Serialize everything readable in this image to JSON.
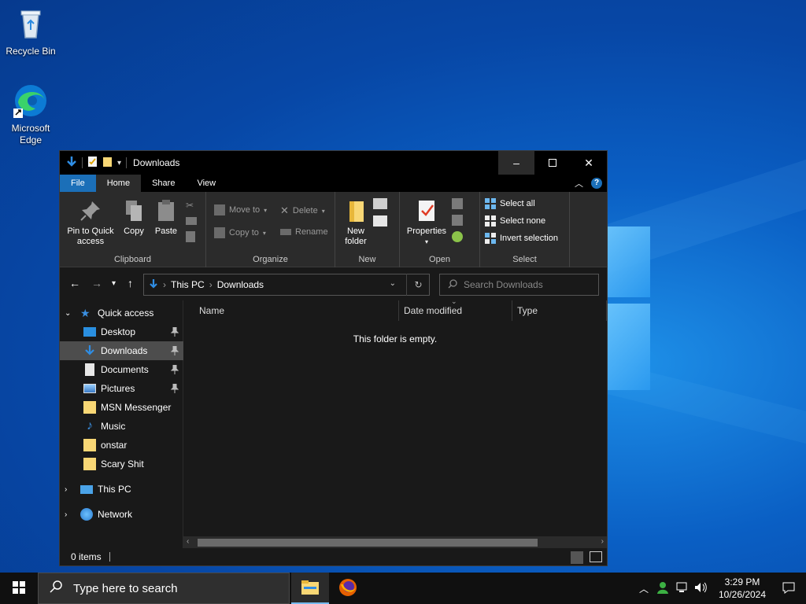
{
  "desktop": {
    "icons": [
      {
        "label": "Recycle Bin"
      },
      {
        "label_line1": "Microsoft",
        "label_line2": "Edge"
      }
    ]
  },
  "window": {
    "title": "Downloads",
    "tabs": [
      {
        "label": "File"
      },
      {
        "label": "Home"
      },
      {
        "label": "Share"
      },
      {
        "label": "View"
      }
    ],
    "ribbon": {
      "clipboard": {
        "pin_line1": "Pin to Quick",
        "pin_line2": "access",
        "copy": "Copy",
        "paste": "Paste",
        "label": "Clipboard"
      },
      "organize": {
        "move_to": "Move to",
        "copy_to": "Copy to",
        "delete": "Delete",
        "rename": "Rename",
        "label": "Organize"
      },
      "new": {
        "folder_line1": "New",
        "folder_line2": "folder",
        "label": "New"
      },
      "open": {
        "properties": "Properties",
        "label": "Open"
      },
      "select": {
        "select_all": "Select all",
        "select_none": "Select none",
        "invert": "Invert selection",
        "label": "Select"
      }
    },
    "address": {
      "crumbs": [
        "This PC",
        "Downloads"
      ]
    },
    "search": {
      "placeholder": "Search Downloads"
    },
    "nav": {
      "quick_access": "Quick access",
      "items": [
        {
          "label": "Desktop"
        },
        {
          "label": "Downloads"
        },
        {
          "label": "Documents"
        },
        {
          "label": "Pictures"
        },
        {
          "label": "MSN Messenger"
        },
        {
          "label": "Music"
        },
        {
          "label": "onstar"
        },
        {
          "label": "Scary Shit"
        }
      ],
      "this_pc": "This PC",
      "network": "Network"
    },
    "columns": [
      "Name",
      "Date modified",
      "Type"
    ],
    "empty_message": "This folder is empty.",
    "status": "0 items"
  },
  "taskbar": {
    "search_placeholder": "Type here to search",
    "time": "3:29 PM",
    "date": "10/26/2024"
  },
  "colors": {
    "accent": "#1b6fb8",
    "selected": "#4d4d4d",
    "folder": "#f8d775"
  }
}
